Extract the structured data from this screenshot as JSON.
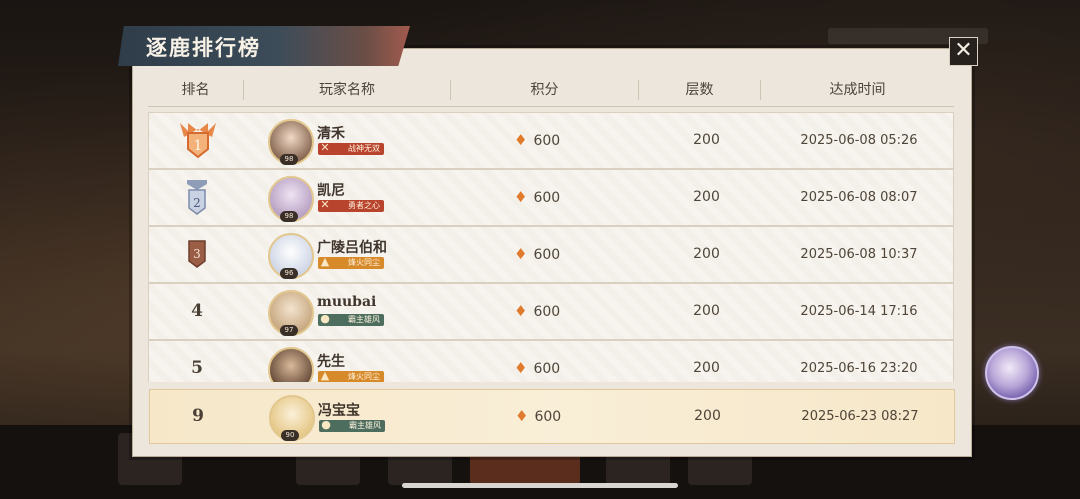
{
  "title": "逐鹿排行榜",
  "close_icon": "close-icon",
  "columns": [
    "排名",
    "玩家名称",
    "积分",
    "层数",
    "达成时间"
  ],
  "rows": [
    {
      "rank": "1",
      "name": "清禾",
      "level": "98",
      "badge_title": "战神无双",
      "badge_color": "#b8442e",
      "avatar_color": "#8a6a55",
      "score": "600",
      "floors": "200",
      "time": "2025-06-08 05:26"
    },
    {
      "rank": "2",
      "name": "凯尼",
      "level": "98",
      "badge_title": "勇者之心",
      "badge_color": "#b8442e",
      "avatar_color": "#b9a3c4",
      "score": "600",
      "floors": "200",
      "time": "2025-06-08 08:07"
    },
    {
      "rank": "3",
      "name": "广陵吕伯和",
      "level": "96",
      "badge_title": "烽火同尘",
      "badge_color": "#d78a2a",
      "avatar_color": "#cfd6e6",
      "score": "600",
      "floors": "200",
      "time": "2025-06-08 10:37"
    },
    {
      "rank": "4",
      "name": "muubai",
      "level": "97",
      "badge_title": "霸主雄风",
      "badge_color": "#4d6e5e",
      "avatar_color": "#c8a982",
      "score": "600",
      "floors": "200",
      "time": "2025-06-14 17:16"
    },
    {
      "rank": "5",
      "name": "先生",
      "level": "",
      "badge_title": "烽火同尘",
      "badge_color": "#d78a2a",
      "avatar_color": "#6b4f3c",
      "score": "600",
      "floors": "200",
      "time": "2025-06-16 23:20"
    }
  ],
  "my_row": {
    "rank": "9",
    "name": "冯宝宝",
    "level": "90",
    "badge_title": "霸主雄风",
    "badge_color": "#4d6e5e",
    "avatar_color": "#e6c98a",
    "score": "600",
    "floors": "200",
    "time": "2025-06-23 08:27"
  }
}
